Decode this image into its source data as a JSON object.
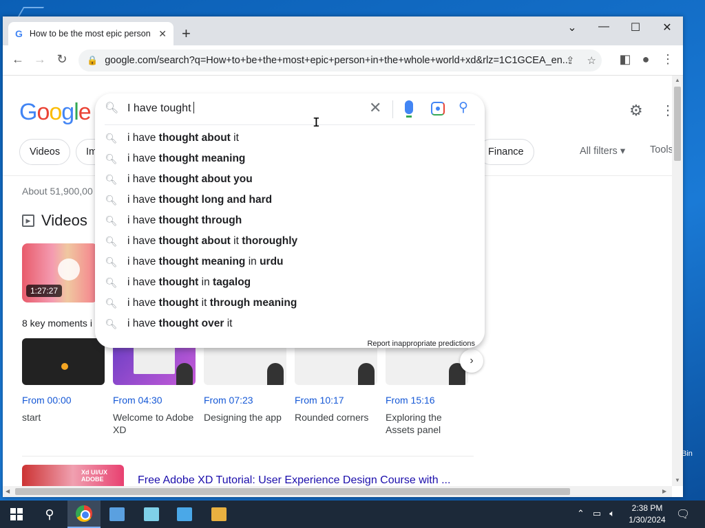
{
  "browser": {
    "tab_title": "How to be the most epic person",
    "tab_favicon": "G",
    "new_tab": "+",
    "url": "google.com/search?q=How+to+be+the+most+epic+person+in+the+whole+world+xd&rlz=1C1GCEA_en..."
  },
  "google": {
    "logo": [
      "G",
      "o",
      "o",
      "g",
      "l",
      "e"
    ],
    "search_query": "I have tought",
    "chips": [
      "Videos",
      "Im",
      "Finance"
    ],
    "all_filters": "All filters ▾",
    "tools": "Tools",
    "about": "About 51,900,00",
    "videos_heading": "Videos",
    "main_video_duration": "1:27:27",
    "key_moments": "8 key moments i",
    "moments": [
      {
        "from": "From 00:00",
        "label": "start"
      },
      {
        "from": "From 04:30",
        "label": "Welcome to Adobe XD"
      },
      {
        "from": "From 07:23",
        "label": "Designing the app"
      },
      {
        "from": "From 10:17",
        "label": "Rounded corners"
      },
      {
        "from": "From 15:16",
        "label": "Exploring the Assets panel"
      }
    ],
    "result_badge": "Xd UI/UX ADOBE",
    "result_link": "Free Adobe XD Tutorial: User Experience Design Course with ..."
  },
  "suggestions": {
    "prefix": "i have ",
    "items": [
      [
        {
          "t": "thought about ",
          "b": true
        },
        {
          "t": "it",
          "b": false
        }
      ],
      [
        {
          "t": "thought meaning",
          "b": true
        }
      ],
      [
        {
          "t": "thought about you",
          "b": true
        }
      ],
      [
        {
          "t": "thought long and hard",
          "b": true
        }
      ],
      [
        {
          "t": "thought through",
          "b": true
        }
      ],
      [
        {
          "t": "thought about ",
          "b": true
        },
        {
          "t": "it ",
          "b": false
        },
        {
          "t": "thoroughly",
          "b": true
        }
      ],
      [
        {
          "t": "thought meaning ",
          "b": true
        },
        {
          "t": "in ",
          "b": false
        },
        {
          "t": "urdu",
          "b": true
        }
      ],
      [
        {
          "t": "thought ",
          "b": true
        },
        {
          "t": "in ",
          "b": false
        },
        {
          "t": "tagalog",
          "b": true
        }
      ],
      [
        {
          "t": "thought ",
          "b": true
        },
        {
          "t": "it ",
          "b": false
        },
        {
          "t": "through meaning",
          "b": true
        }
      ],
      [
        {
          "t": "thought over ",
          "b": true
        },
        {
          "t": "it",
          "b": false
        }
      ]
    ],
    "report": "Report inappropriate predictions"
  },
  "taskbar": {
    "time": "2:38 PM",
    "date": "1/30/2024"
  },
  "desktop": {
    "bin_label": "Bin"
  },
  "colors": {
    "google_blue": "#4285f4",
    "link_blue": "#1a0dab",
    "taskbar": "#1c2939"
  }
}
